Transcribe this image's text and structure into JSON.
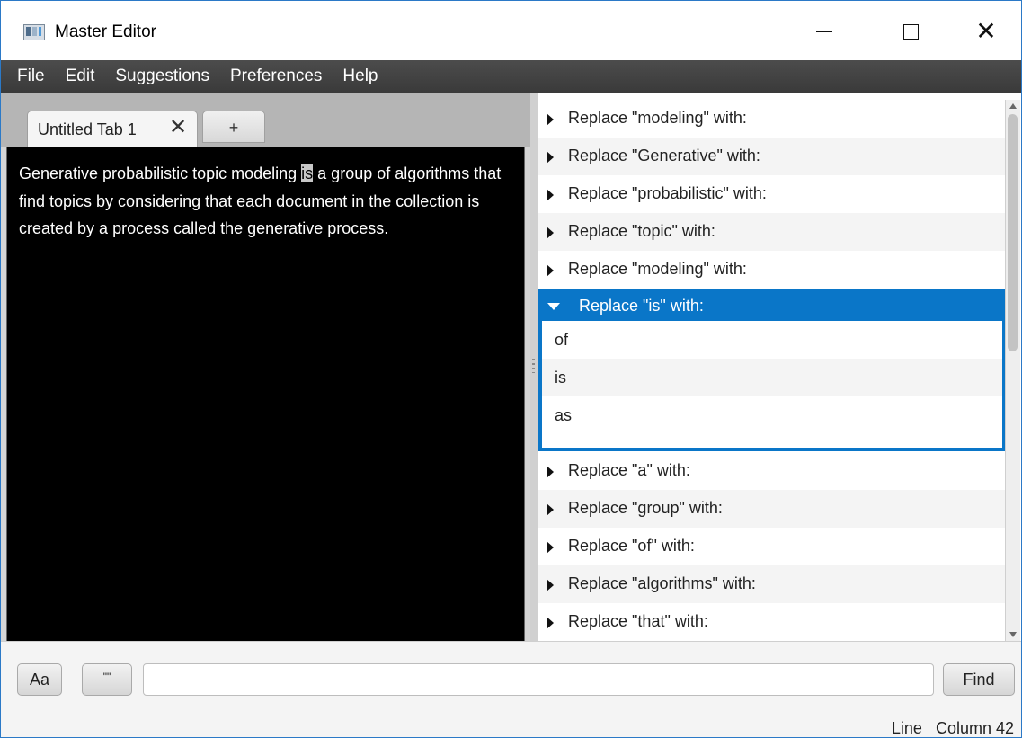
{
  "window": {
    "title": "Master Editor",
    "controls": {
      "minimize": "minimize-icon",
      "maximize": "maximize-icon",
      "close": "close-icon"
    }
  },
  "menubar": {
    "items": [
      "File",
      "Edit",
      "Suggestions",
      "Preferences",
      "Help"
    ]
  },
  "tabs": {
    "items": [
      {
        "label": "Untitled Tab 1",
        "close": "✕"
      }
    ],
    "add_label": "+"
  },
  "editor": {
    "text_before": "Generative probabilistic topic modeling ",
    "selected_word": "is",
    "text_after": " a group of algorithms that find topics by considering that each document in the collection is created by a process called the generative process."
  },
  "suggestions": {
    "items_before": [
      "Replace \"modeling\" with:",
      "Replace \"Generative\" with:",
      "Replace \"probabilistic\" with:",
      "Replace \"topic\" with:",
      "Replace \"modeling\" with:"
    ],
    "expanded": {
      "label": "Replace \"is\" with:",
      "options": [
        "of",
        "is",
        "as"
      ]
    },
    "items_after": [
      "Replace \"a\" with:",
      "Replace \"group\" with:",
      "Replace \"of\" with:",
      "Replace \"algorithms\" with:",
      "Replace \"that\" with:"
    ]
  },
  "findbar": {
    "case_button": "Aa",
    "quote_button": "\"\"",
    "search_value": "",
    "find_button": "Find"
  },
  "status": {
    "line_label": "Line",
    "column_label": "Column 42"
  },
  "colors": {
    "menubar": "#3f3f3f",
    "editor_bg": "#000000",
    "selection_accent": "#0a76c8"
  }
}
